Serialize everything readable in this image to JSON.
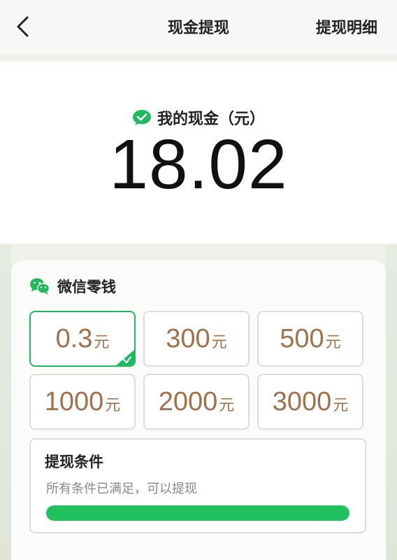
{
  "header": {
    "title": "现金提现",
    "detail_link": "提现明细"
  },
  "balance": {
    "label": "我的现金（元）",
    "amount": "18.02"
  },
  "wallet": {
    "title": "微信零钱",
    "options": [
      {
        "value": "0.3",
        "unit": "元",
        "selected": true
      },
      {
        "value": "300",
        "unit": "元",
        "selected": false
      },
      {
        "value": "500",
        "unit": "元",
        "selected": false
      },
      {
        "value": "1000",
        "unit": "元",
        "selected": false
      },
      {
        "value": "2000",
        "unit": "元",
        "selected": false
      },
      {
        "value": "3000",
        "unit": "元",
        "selected": false
      }
    ]
  },
  "condition": {
    "title": "提现条件",
    "description": "所有条件已满足，可以提现",
    "progress_percent": 100
  },
  "colors": {
    "accent": "#20b95e",
    "amount_text": "#a0714a"
  },
  "icons": {
    "back": "chevron-left-icon",
    "balance": "wechat-pay-check-icon",
    "wallet": "wechat-icon",
    "selected": "check-icon"
  }
}
